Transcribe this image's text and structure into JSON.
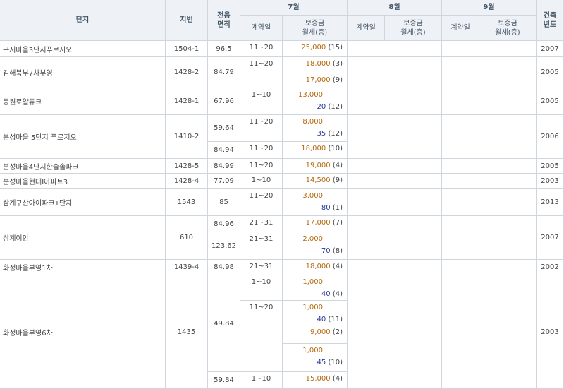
{
  "header": {
    "complex": "단지",
    "lot": "지번",
    "area": "전용\n면적",
    "months": [
      "7월",
      "8월",
      "9월"
    ],
    "contract_day": "계약일",
    "price": "보증금\n월세(층)",
    "built_year": "건축\n년도"
  },
  "rows": [
    {
      "name": "구지마을3단지푸르지오",
      "lot": "1504-1",
      "year": "2007",
      "areas": [
        {
          "area": "96.5",
          "days": [
            {
              "day": "11~20",
              "items": [
                {
                  "deposit": "25,000",
                  "floor": "(15)"
                }
              ]
            }
          ]
        }
      ]
    },
    {
      "name": "김해북부7차부영",
      "lot": "1428-2",
      "year": "2005",
      "areas": [
        {
          "area": "84.79",
          "days": [
            {
              "day": "11~20",
              "items": [
                {
                  "deposit": "18,000",
                  "floor": "(3)"
                },
                {
                  "deposit": "17,000",
                  "floor": "(9)"
                }
              ]
            }
          ]
        }
      ]
    },
    {
      "name": "동원로얄듀크",
      "lot": "1428-1",
      "year": "2005",
      "areas": [
        {
          "area": "67.96",
          "days": [
            {
              "day": "1~10",
              "items": [
                {
                  "deposit": "13,000",
                  "rent": "20",
                  "floor": "(12)"
                }
              ]
            }
          ]
        }
      ]
    },
    {
      "name": "분성마을 5단지 푸르지오",
      "lot": "1410-2",
      "year": "2006",
      "areas": [
        {
          "area": "59.64",
          "days": [
            {
              "day": "11~20",
              "items": [
                {
                  "deposit": "8,000",
                  "rent": "35",
                  "floor": "(12)"
                }
              ]
            }
          ]
        },
        {
          "area": "84.94",
          "days": [
            {
              "day": "11~20",
              "items": [
                {
                  "deposit": "18,000",
                  "floor": "(10)"
                }
              ]
            }
          ]
        }
      ]
    },
    {
      "name": "분성마을4단지한솔솔파크",
      "lot": "1428-5",
      "year": "2005",
      "areas": [
        {
          "area": "84.99",
          "days": [
            {
              "day": "11~20",
              "items": [
                {
                  "deposit": "19,000",
                  "floor": "(4)"
                }
              ]
            }
          ]
        }
      ]
    },
    {
      "name": "분성마을현대I아파트3",
      "lot": "1428-4",
      "year": "2003",
      "areas": [
        {
          "area": "77.09",
          "days": [
            {
              "day": "1~10",
              "items": [
                {
                  "deposit": "14,500",
                  "floor": "(9)"
                }
              ]
            }
          ]
        }
      ]
    },
    {
      "name": "삼계구산아이파크1단지",
      "lot": "1543",
      "year": "2013",
      "areas": [
        {
          "area": "85",
          "days": [
            {
              "day": "11~20",
              "items": [
                {
                  "deposit": "3,000",
                  "rent": "80",
                  "floor": "(1)"
                }
              ]
            }
          ]
        }
      ]
    },
    {
      "name": "삼계이안",
      "lot": "610",
      "year": "2007",
      "areas": [
        {
          "area": "84.96",
          "days": [
            {
              "day": "21~31",
              "items": [
                {
                  "deposit": "17,000",
                  "floor": "(7)"
                }
              ]
            }
          ]
        },
        {
          "area": "123.62",
          "days": [
            {
              "day": "21~31",
              "items": [
                {
                  "deposit": "2,000",
                  "rent": "70",
                  "floor": "(8)"
                }
              ]
            }
          ]
        }
      ]
    },
    {
      "name": "화정마을부영1차",
      "lot": "1439-4",
      "year": "2002",
      "areas": [
        {
          "area": "84.98",
          "days": [
            {
              "day": "21~31",
              "items": [
                {
                  "deposit": "18,000",
                  "floor": "(4)"
                }
              ]
            }
          ]
        }
      ]
    },
    {
      "name": "화정마을부영6차",
      "lot": "1435",
      "year": "2003",
      "areas": [
        {
          "area": "49.84",
          "days": [
            {
              "day": "1~10",
              "items": [
                {
                  "deposit": "1,000",
                  "rent": "40",
                  "floor": "(4)"
                }
              ]
            },
            {
              "day": "11~20",
              "items": [
                {
                  "deposit": "1,000",
                  "rent": "40",
                  "floor": "(11)"
                },
                {
                  "deposit": "9,000",
                  "floor": "(2)"
                },
                {
                  "deposit": "1,000",
                  "rent": "45",
                  "floor": "(10)"
                }
              ]
            }
          ]
        },
        {
          "area": "59.84",
          "days": [
            {
              "day": "1~10",
              "items": [
                {
                  "deposit": "15,000",
                  "floor": "(4)"
                }
              ]
            }
          ]
        }
      ]
    }
  ]
}
